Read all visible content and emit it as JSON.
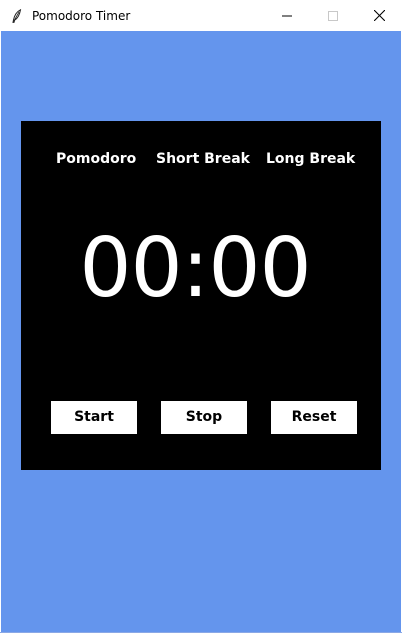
{
  "window": {
    "title": "Pomodoro Timer",
    "app_icon": "feather-icon",
    "controls": {
      "minimize_icon": "minimize-icon",
      "maximize_icon": "maximize-icon",
      "close_icon": "close-icon"
    }
  },
  "colors": {
    "background": "#6495ed",
    "panel": "#000000",
    "text": "#ffffff",
    "button_bg": "#ffffff",
    "button_text": "#000000"
  },
  "tabs": [
    {
      "label": "Pomodoro"
    },
    {
      "label": "Short Break"
    },
    {
      "label": "Long Break"
    }
  ],
  "timer": {
    "display": "00:00"
  },
  "buttons": {
    "start": "Start",
    "stop": "Stop",
    "reset": "Reset"
  }
}
